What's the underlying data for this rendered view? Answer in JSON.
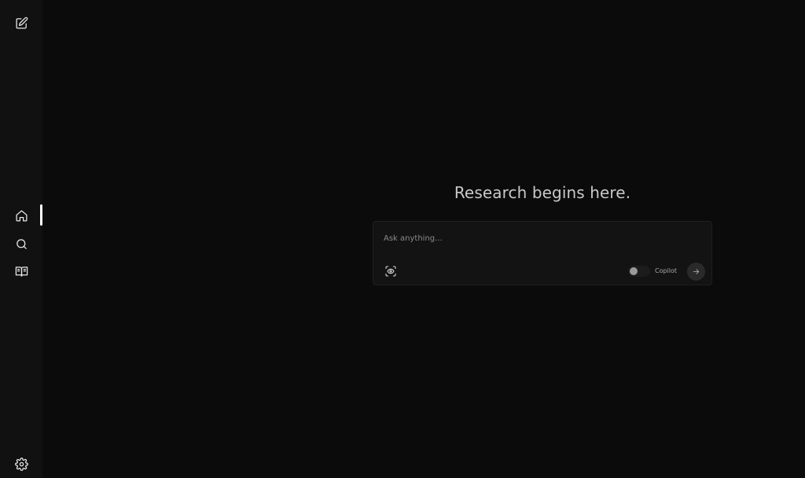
{
  "sidebar": {
    "items": [
      {
        "id": "new-thread",
        "icon": "edit-icon"
      },
      {
        "id": "home",
        "icon": "home-icon",
        "active": true
      },
      {
        "id": "discover",
        "icon": "search-icon"
      },
      {
        "id": "library",
        "icon": "book-open-icon"
      }
    ],
    "settings_icon": "gear-icon"
  },
  "main": {
    "title": "Research begins here.",
    "composer": {
      "placeholder": "Ask anything...",
      "value": "",
      "focus_icon": "focus-eye-icon",
      "copilot_label": "Copilot",
      "copilot_enabled": false,
      "send_icon": "arrow-right-icon"
    }
  },
  "colors": {
    "background": "#0b0b0b",
    "sidebar": "#111111",
    "composer": "#131313",
    "active_indicator": "#ffffff"
  }
}
